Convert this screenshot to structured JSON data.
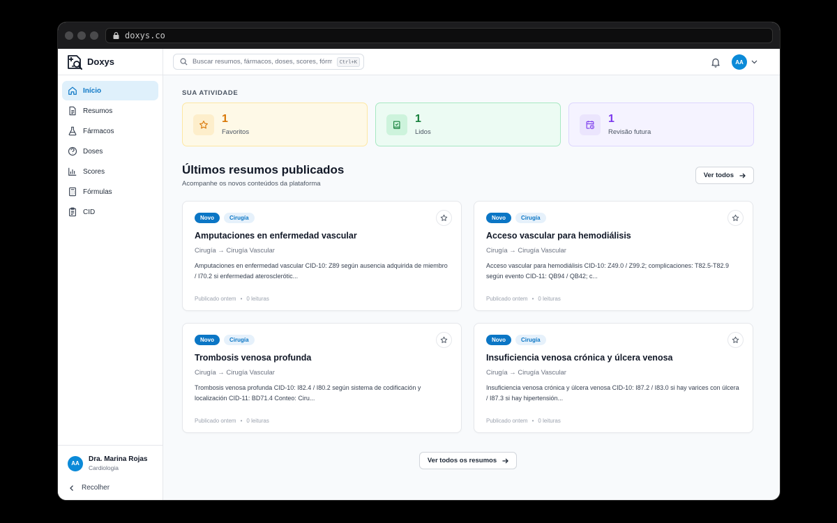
{
  "browser": {
    "url": "doxys.co"
  },
  "app": {
    "name": "Doxys"
  },
  "search": {
    "placeholder": "Buscar resumos, fármacos, doses, scores, fórmulas",
    "shortcut": "Ctrl+K"
  },
  "topbar": {
    "avatar_initials": "AA"
  },
  "sidebar": {
    "items": [
      {
        "label": "Início",
        "icon": "home-icon",
        "active": true
      },
      {
        "label": "Resumos",
        "icon": "document-icon"
      },
      {
        "label": "Fármacos",
        "icon": "flask-icon"
      },
      {
        "label": "Doses",
        "icon": "dose-icon"
      },
      {
        "label": "Scores",
        "icon": "chart-icon"
      },
      {
        "label": "Fórmulas",
        "icon": "calculator-icon"
      },
      {
        "label": "CID",
        "icon": "clipboard-icon"
      }
    ],
    "user": {
      "initials": "AA",
      "name": "Dra. Marina Rojas",
      "role": "Cardiologia"
    },
    "collapse_label": "Recolher"
  },
  "activity": {
    "label": "SUA ATIVIDADE",
    "stats": [
      {
        "value": "1",
        "label": "Favoritos",
        "color": "#d97706",
        "bg": "#fef9e7",
        "border": "#fde7a3",
        "icon_bg": "#fdeecb",
        "icon": "star-icon"
      },
      {
        "value": "1",
        "label": "Lidos",
        "color": "#16803c",
        "bg": "#ecfbf3",
        "border": "#a7e8c2",
        "icon_bg": "#cdf3dc",
        "icon": "book-icon"
      },
      {
        "value": "1",
        "label": "Revisão futura",
        "color": "#7c3aed",
        "bg": "#f5f3ff",
        "border": "#ddd6fe",
        "icon_bg": "#ebe5fd",
        "icon": "calendar-clock-icon"
      }
    ]
  },
  "latest": {
    "title": "Últimos resumos publicados",
    "subtitle": "Acompanhe os novos conteúdos da plataforma",
    "view_all": "Ver todos",
    "view_all_bottom": "Ver todos os resumos",
    "cards": [
      {
        "badge_new": "Novo",
        "badge_category": "Cirugía",
        "title": "Amputaciones en enfermedad vascular",
        "path": "Cirugía → Cirugía Vascular",
        "description": "Amputaciones en enfermedad vascular CID-10: Z89 según ausencia adquirida de miembro / I70.2 si enfermedad aterosclerótic...",
        "published": "Publicado ontem",
        "reads": "0 leituras"
      },
      {
        "badge_new": "Novo",
        "badge_category": "Cirugía",
        "title": "Acceso vascular para hemodiálisis",
        "path": "Cirugía → Cirugía Vascular",
        "description": "Acceso vascular para hemodiálisis CID-10: Z49.0 / Z99.2; complicaciones: T82.5-T82.9 según evento CID-11: QB94 / QB42; c...",
        "published": "Publicado ontem",
        "reads": "0 leituras"
      },
      {
        "badge_new": "Novo",
        "badge_category": "Cirugía",
        "title": "Trombosis venosa profunda",
        "path": "Cirugía → Cirugía Vascular",
        "description": "Trombosis venosa profunda CID-10: I82.4 / I80.2 según sistema de codificación y localización CID-11: BD71.4 Conteo: Ciru...",
        "published": "Publicado ontem",
        "reads": "0 leituras"
      },
      {
        "badge_new": "Novo",
        "badge_category": "Cirugía",
        "title": "Insuficiencia venosa crónica y úlcera venosa",
        "path": "Cirugía → Cirugía Vascular",
        "description": "Insuficiencia venosa crónica y úlcera venosa CID-10: I87.2 / I83.0 si hay varices con úlcera / I87.3 si hay hipertensión...",
        "published": "Publicado ontem",
        "reads": "0 leituras"
      }
    ]
  }
}
